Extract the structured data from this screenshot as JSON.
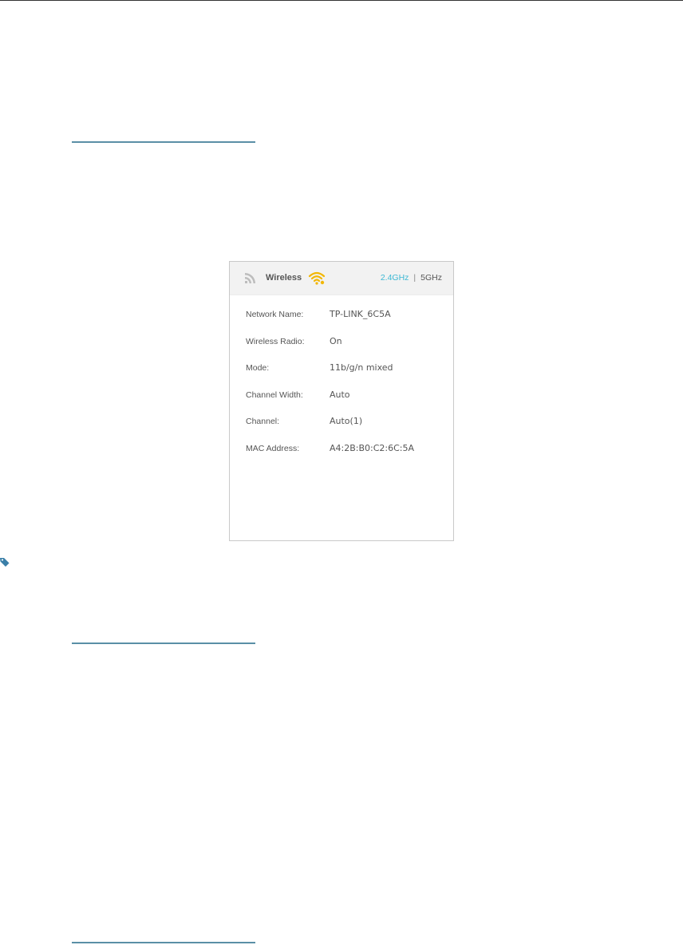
{
  "panel": {
    "title": "Wireless",
    "icons": {
      "header": "signal-bars-icon",
      "status": "wifi-icon"
    },
    "bands": {
      "active": "2.4GHz",
      "separator": "|",
      "inactive": "5GHz"
    },
    "rows": [
      {
        "label": "Network Name:",
        "value": "TP-LINK_6C5A"
      },
      {
        "label": "Wireless Radio:",
        "value": "On"
      },
      {
        "label": "Mode:",
        "value": "11b/g/n mixed"
      },
      {
        "label": "Channel Width:",
        "value": "Auto"
      },
      {
        "label": "Channel:",
        "value": "Auto(1)"
      },
      {
        "label": "MAC Address:",
        "value": "A4:2B:B0:C2:6C:5A"
      }
    ]
  },
  "colors": {
    "accent": "#3cb8d4",
    "wifi": "#f2b705",
    "rule": "#5a8fa6",
    "text": "#555555"
  }
}
